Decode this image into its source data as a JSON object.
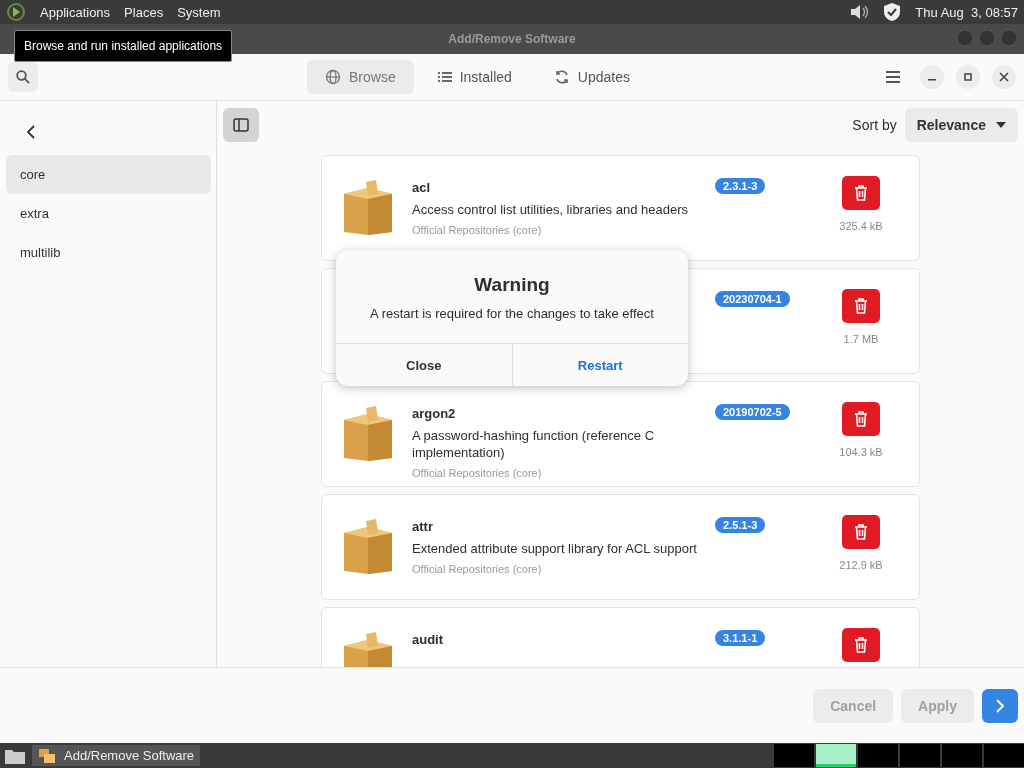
{
  "top_panel": {
    "menus": [
      "Applications",
      "Places",
      "System"
    ],
    "clock": "Thu Aug  3, 08:57"
  },
  "tooltip": "Browse and run installed applications",
  "window": {
    "title": "Add/Remove Software"
  },
  "tabs": [
    {
      "label": "Browse",
      "selected": true,
      "kind": "globe"
    },
    {
      "label": "Installed",
      "selected": false,
      "kind": "list"
    },
    {
      "label": "Updates",
      "selected": false,
      "kind": "refresh"
    }
  ],
  "sidebar": {
    "items": [
      {
        "label": "core",
        "selected": true
      },
      {
        "label": "extra",
        "selected": false
      },
      {
        "label": "multilib",
        "selected": false
      }
    ]
  },
  "toolbar": {
    "sidebar_toggle_on": true,
    "sort_label": "Sort by",
    "sort_value": "Relevance"
  },
  "packages": [
    {
      "name": "acl",
      "description": "Access control list utilities, libraries and headers",
      "repository": "Official Repositories (core)",
      "version": "2.3.1-3",
      "size": "325.4 kB"
    },
    {
      "version": "20230704-1",
      "size": "1.7 MB"
    },
    {
      "name": "argon2",
      "description": "A password-hashing function (reference C implementation)",
      "repository": "Official Repositories (core)",
      "version": "20190702-5",
      "size": "104.3 kB"
    },
    {
      "name": "attr",
      "description": "Extended attribute support library for ACL support",
      "repository": "Official Repositories (core)",
      "version": "2.5.1-3",
      "size": "212.9 kB"
    },
    {
      "name": "audit",
      "version": "3.1.1-1"
    }
  ],
  "dialog": {
    "title": "Warning",
    "message": "A restart is required for the changes to take effect",
    "buttons": [
      "Close",
      "Restart"
    ]
  },
  "footer": {
    "buttons": [
      {
        "label": "Cancel",
        "disabled": true
      },
      {
        "label": "Apply",
        "disabled": true
      }
    ]
  },
  "taskbar": {
    "tasks": [
      "Add/Remove Software"
    ],
    "workspaces": [
      {
        "selected": false
      },
      {
        "selected": true
      },
      {
        "selected": false
      },
      {
        "selected": false
      },
      {
        "selected": false
      },
      {
        "selected": false
      }
    ]
  }
}
